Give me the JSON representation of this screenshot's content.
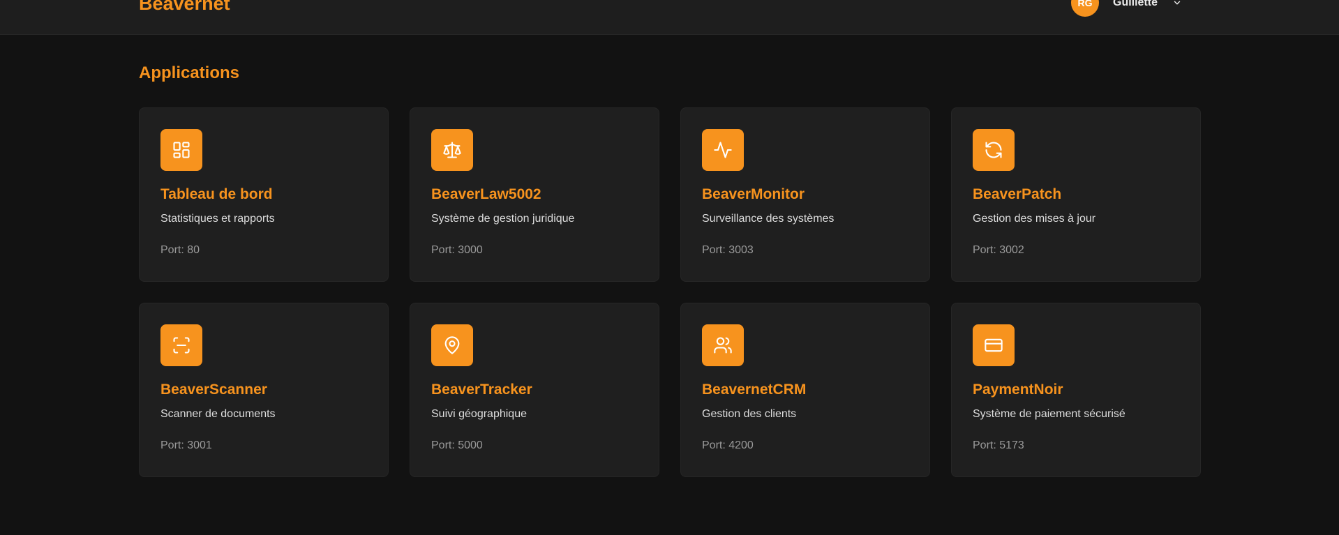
{
  "header": {
    "brand": "Beavernet",
    "user": {
      "initials": "RG",
      "name": "Guillette",
      "menu_icon": "chevron-down-icon"
    }
  },
  "main": {
    "section_title": "Applications",
    "apps": [
      {
        "title": "Tableau de bord",
        "description": "Statistiques et rapports",
        "port": "Port: 80",
        "icon": "dashboard-grid-icon"
      },
      {
        "title": "BeaverLaw5002",
        "description": "Système de gestion juridique",
        "port": "Port: 3000",
        "icon": "scale-icon"
      },
      {
        "title": "BeaverMonitor",
        "description": "Surveillance des systèmes",
        "port": "Port: 3003",
        "icon": "activity-icon"
      },
      {
        "title": "BeaverPatch",
        "description": "Gestion des mises à jour",
        "port": "Port: 3002",
        "icon": "refresh-icon"
      },
      {
        "title": "BeaverScanner",
        "description": "Scanner de documents",
        "port": "Port: 3001",
        "icon": "scan-icon"
      },
      {
        "title": "BeaverTracker",
        "description": "Suivi géographique",
        "port": "Port: 5000",
        "icon": "map-pin-icon"
      },
      {
        "title": "BeavernetCRM",
        "description": "Gestion des clients",
        "port": "Port: 4200",
        "icon": "users-icon"
      },
      {
        "title": "PaymentNoir",
        "description": "Système de paiement sécurisé",
        "port": "Port: 5173",
        "icon": "credit-card-icon"
      }
    ]
  },
  "colors": {
    "accent": "#f7931e",
    "background": "#121212",
    "card": "#1f1f1f",
    "header": "#1e1e1e"
  }
}
